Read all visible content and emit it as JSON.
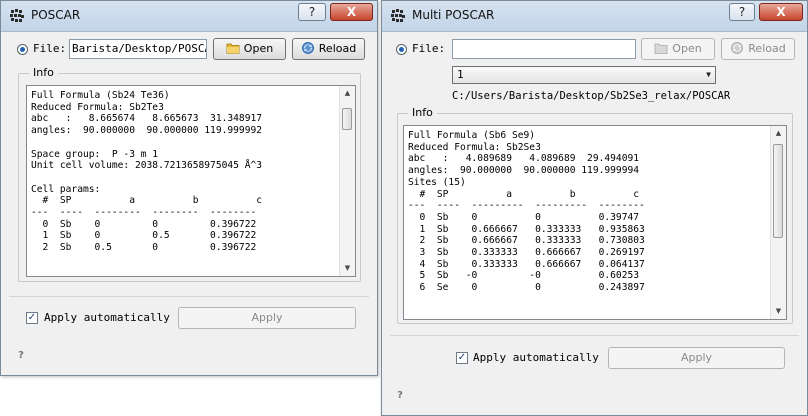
{
  "poscar_window": {
    "title": "POSCAR",
    "file_label": "File:",
    "file_value": "Barista/Desktop/POSCAR",
    "open_label": "Open",
    "reload_label": "Reload",
    "info_label": "Info",
    "info_text": "Full Formula (Sb24 Te36)\nReduced Formula: Sb2Te3\nabc   :   8.665674   8.665673  31.348917\nangles:  90.000000  90.000000 119.999992\n\nSpace group:  P -3 m 1\nUnit cell volume: 2038.7213658975045 Å^3\n\nCell params:\n  #  SP          a          b          c\n---  ----  --------  --------  --------\n  0  Sb    0         0         0.396722\n  1  Sb    0         0.5       0.396722\n  2  Sb    0.5       0         0.396722",
    "apply_auto_label": "Apply automatically",
    "apply_auto_checked": true,
    "apply_label": "Apply",
    "help_icon": "question-mark"
  },
  "multi_window": {
    "title": "Multi POSCAR",
    "file_label": "File:",
    "file_value": "",
    "open_label": "Open",
    "reload_label": "Reload",
    "select_value": "1",
    "path_text": "C:/Users/Barista/Desktop/Sb2Se3_relax/POSCAR",
    "info_label": "Info",
    "info_text": "Full Formula (Sb6 Se9)\nReduced Formula: Sb2Se3\nabc   :   4.089689   4.089689  29.494091\nangles:  90.000000  90.000000 119.999994\nSites (15)\n  #  SP          a          b          c\n---  ----  ---------  ---------  --------\n  0  Sb    0          0          0.39747\n  1  Sb    0.666667   0.333333   0.935863\n  2  Sb    0.666667   0.333333   0.730803\n  3  Sb    0.333333   0.666667   0.269197\n  4  Sb    0.333333   0.666667   0.064137\n  5  Sb   -0         -0          0.60253\n  6  Se    0          0          0.243897",
    "apply_auto_label": "Apply automatically",
    "apply_auto_checked": true,
    "apply_label": "Apply",
    "help_icon": "question-mark"
  },
  "title_buttons": {
    "help": "?",
    "close": "X"
  },
  "colors": {
    "titlebar": "#c8d8ea",
    "window_bg": "#f0f0f0",
    "close_button": "#c6452e"
  }
}
